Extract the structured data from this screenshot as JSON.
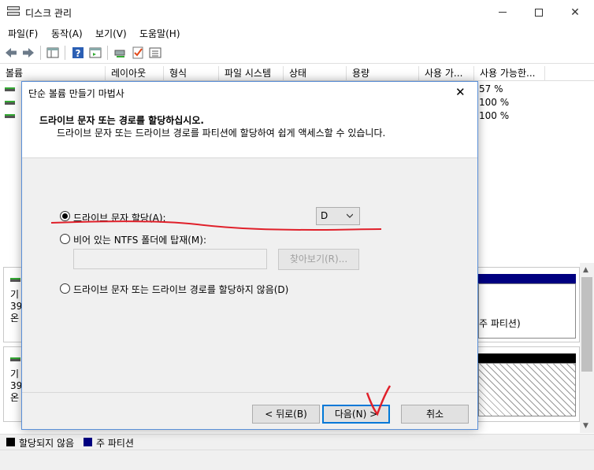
{
  "window": {
    "title": "디스크 관리"
  },
  "menu": {
    "items": [
      "파일(F)",
      "동작(A)",
      "보기(V)",
      "도움말(H)"
    ]
  },
  "toolbar": {
    "icons": [
      "back-icon",
      "forward-icon",
      "console-tree-icon",
      "help-icon",
      "action-pane-icon",
      "connect-icon",
      "check-icon",
      "list-view-icon"
    ]
  },
  "volume_list": {
    "columns": [
      "볼륨",
      "레이아웃",
      "형식",
      "파일 시스템",
      "상태",
      "용량",
      "사용 가...",
      "사용 가능한..."
    ],
    "rows": [
      {
        "free_pct": "57 %"
      },
      {
        "free_pct": "100 %"
      },
      {
        "free_pct": "100 %"
      }
    ]
  },
  "disks": [
    {
      "info": [
        "기",
        "39",
        "온"
      ],
      "partition_note": "주 파티션)"
    },
    {
      "info": [
        "기",
        "39",
        "온"
      ]
    }
  ],
  "legend": {
    "items": [
      {
        "label": "할당되지 않음",
        "color": "#000000"
      },
      {
        "label": "주 파티션",
        "color": "#000080"
      }
    ]
  },
  "dialog": {
    "title": "단순 볼륨 만들기 마법사",
    "heading": "드라이브 문자 또는 경로를 할당하십시오.",
    "subheading": "드라이브 문자 또는 드라이브 경로를 파티션에 할당하여 쉽게 액세스할 수 있습니다.",
    "options": {
      "assign_letter": "드라이브 문자 할당(A):",
      "mount_folder": "비어 있는 NTFS 폴더에 탑재(M):",
      "no_assign": "드라이브 문자 또는 드라이브 경로를 할당하지 않음(D)"
    },
    "selected_option": "assign_letter",
    "drive_letter": "D",
    "browse_label": "찾아보기(R)...",
    "back_label": "< 뒤로(B)",
    "next_label": "다음(N) >",
    "cancel_label": "취소"
  },
  "annotation": {
    "color": "#e0202a"
  }
}
